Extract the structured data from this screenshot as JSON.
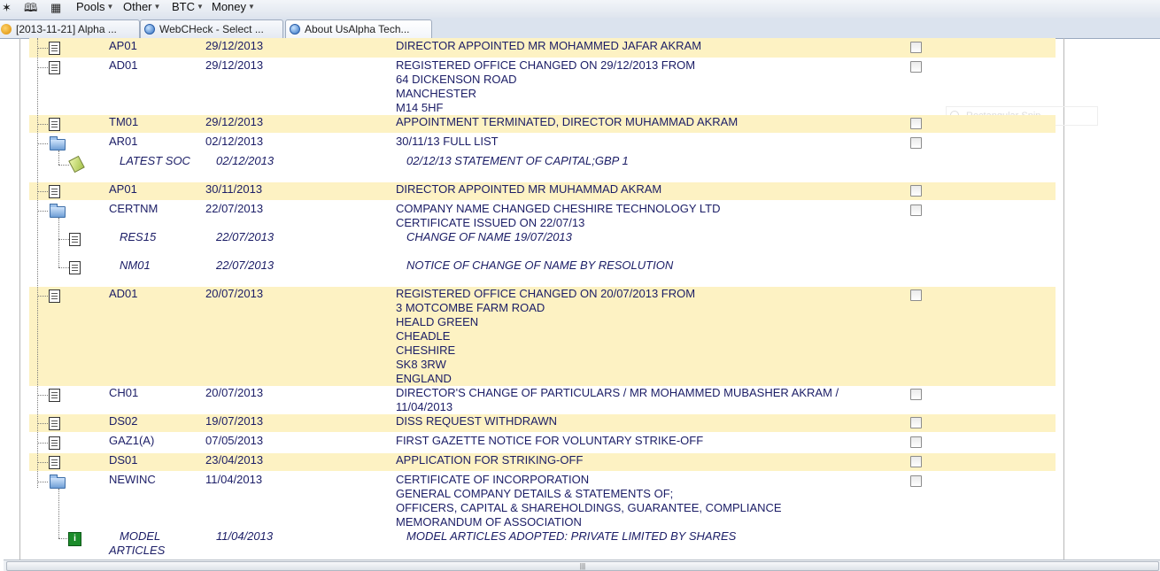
{
  "browser": {
    "menus": [
      "Pools",
      "Other",
      "BTC",
      "Money"
    ],
    "toolbar_icons": [
      "glasses-icon",
      "book-icon",
      "grid-icon"
    ],
    "tabs": [
      {
        "label": "[2013-11-21] Alpha ...",
        "icon": "coin-icon"
      },
      {
        "label": "WebCHeck - Select ...",
        "icon": "globe-icon"
      },
      {
        "label": "About UsAlpha Tech...",
        "icon": "globe-icon"
      }
    ],
    "overlay_text": "Rectangular Snip",
    "scroll_grip": "|||"
  },
  "filings": [
    {
      "type": "AP01",
      "date": "29/12/2013",
      "lines": [
        "DIRECTOR APPOINTED MR MOHAMMED JAFAR AKRAM"
      ]
    },
    {
      "type": "AD01",
      "date": "29/12/2013",
      "lines": [
        "REGISTERED OFFICE CHANGED ON 29/12/2013 FROM",
        "64 DICKENSON ROAD",
        "MANCHESTER",
        "M14 5HF"
      ]
    },
    {
      "type": "TM01",
      "date": "29/12/2013",
      "lines": [
        "APPOINTMENT TERMINATED, DIRECTOR MUHAMMAD AKRAM"
      ]
    },
    {
      "type": "AR01",
      "date": "02/12/2013",
      "lines": [
        "30/11/13 FULL LIST"
      ]
    },
    {
      "type": "LATEST SOC",
      "date": "02/12/2013",
      "lines": [
        "02/12/13 STATEMENT OF CAPITAL;GBP 1"
      ]
    },
    {
      "type": "AP01",
      "date": "30/11/2013",
      "lines": [
        "DIRECTOR APPOINTED MR MUHAMMAD AKRAM"
      ]
    },
    {
      "type": "CERTNM",
      "date": "22/07/2013",
      "lines": [
        "COMPANY NAME CHANGED CHESHIRE TECHNOLOGY LTD",
        "CERTIFICATE ISSUED ON 22/07/13"
      ]
    },
    {
      "type": "RES15",
      "date": "22/07/2013",
      "lines": [
        "CHANGE OF NAME 19/07/2013"
      ]
    },
    {
      "type": "NM01",
      "date": "22/07/2013",
      "lines": [
        "NOTICE OF CHANGE OF NAME BY RESOLUTION"
      ]
    },
    {
      "type": "AD01",
      "date": "20/07/2013",
      "lines": [
        "REGISTERED OFFICE CHANGED ON 20/07/2013 FROM",
        "3 MOTCOMBE FARM ROAD",
        "HEALD GREEN",
        "CHEADLE",
        "CHESHIRE",
        "SK8 3RW",
        "ENGLAND"
      ]
    },
    {
      "type": "CH01",
      "date": "20/07/2013",
      "lines": [
        "DIRECTOR'S CHANGE OF PARTICULARS / MR MOHAMMED MUBASHER AKRAM /",
        "11/04/2013"
      ]
    },
    {
      "type": "DS02",
      "date": "19/07/2013",
      "lines": [
        "DISS REQUEST WITHDRAWN"
      ]
    },
    {
      "type": "GAZ1(A)",
      "date": "07/05/2013",
      "lines": [
        "FIRST GAZETTE NOTICE FOR VOLUNTARY STRIKE-OFF"
      ]
    },
    {
      "type": "DS01",
      "date": "23/04/2013",
      "lines": [
        "APPLICATION FOR STRIKING-OFF"
      ]
    },
    {
      "type": "NEWINC",
      "date": "11/04/2013",
      "lines": [
        "CERTIFICATE OF INCORPORATION",
        "GENERAL COMPANY DETAILS & STATEMENTS OF;",
        "OFFICERS, CAPITAL & SHAREHOLDINGS, GUARANTEE, COMPLIANCE",
        "MEMORANDUM OF ASSOCIATION"
      ]
    },
    {
      "type": "MODEL\nARTICLES",
      "date": "11/04/2013",
      "lines": [
        "MODEL ARTICLES ADOPTED: PRIVATE LIMITED BY SHARES"
      ]
    }
  ],
  "colors": {
    "highlight": "#fdf2c3",
    "text": "#1b1d66"
  }
}
